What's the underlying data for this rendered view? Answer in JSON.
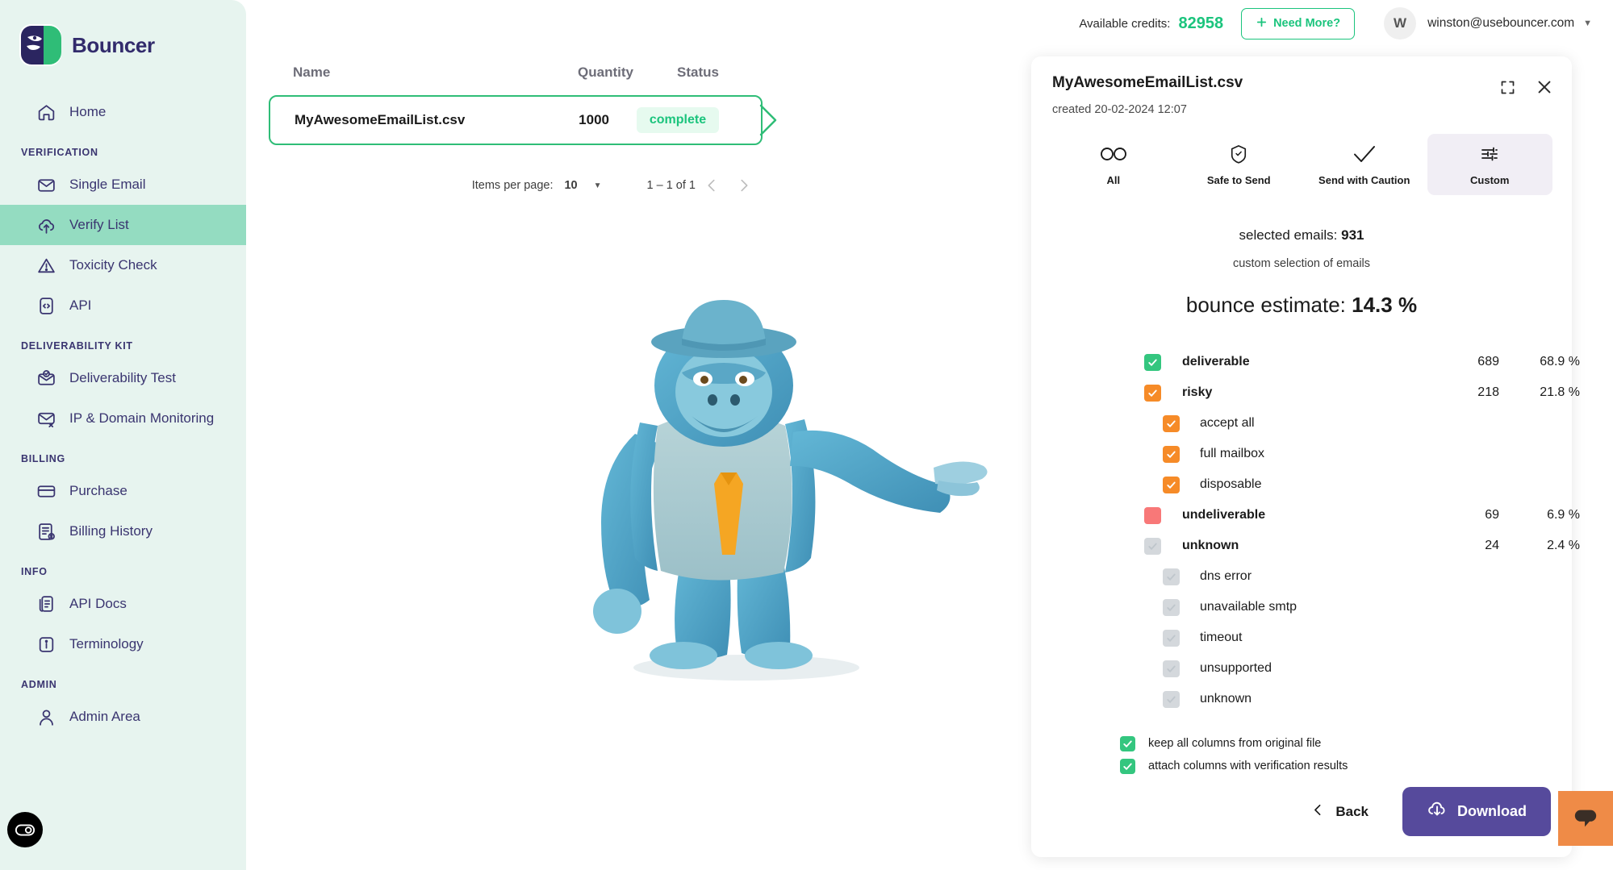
{
  "brand": {
    "name": "Bouncer",
    "logo_icon": "bouncer-gorilla-logo"
  },
  "sidebar": {
    "home": {
      "label": "Home",
      "icon": "home-icon"
    },
    "sections": [
      {
        "title": "VERIFICATION",
        "items": [
          {
            "label": "Single Email",
            "icon": "envelope-icon",
            "active": false
          },
          {
            "label": "Verify List",
            "icon": "cloud-upload-icon",
            "active": true
          },
          {
            "label": "Toxicity Check",
            "icon": "warning-triangle-icon",
            "active": false
          },
          {
            "label": "API",
            "icon": "code-icon",
            "active": false
          }
        ]
      },
      {
        "title": "DELIVERABILITY KIT",
        "items": [
          {
            "label": "Deliverability Test",
            "icon": "envelope-check-icon",
            "active": false
          },
          {
            "label": "IP & Domain Monitoring",
            "icon": "envelope-x-icon",
            "active": false
          }
        ]
      },
      {
        "title": "BILLING",
        "items": [
          {
            "label": "Purchase",
            "icon": "credit-card-icon",
            "active": false
          },
          {
            "label": "Billing History",
            "icon": "invoice-icon",
            "active": false
          }
        ]
      },
      {
        "title": "INFO",
        "items": [
          {
            "label": "API Docs",
            "icon": "document-icon",
            "active": false
          },
          {
            "label": "Terminology",
            "icon": "info-icon",
            "active": false
          }
        ]
      },
      {
        "title": "ADMIN",
        "items": [
          {
            "label": "Admin Area",
            "icon": "user-icon",
            "active": false
          }
        ]
      }
    ],
    "cookie_icon": "cookie-consent-icon"
  },
  "topbar": {
    "credits_label": "Available credits:",
    "credits_value": "82958",
    "need_more_label": "Need More?",
    "plus_icon": "plus-icon",
    "avatar_initial": "W",
    "user_email": "winston@usebouncer.com",
    "caret_icon": "chevron-down-icon"
  },
  "list": {
    "columns": {
      "name": "Name",
      "quantity": "Quantity",
      "status": "Status"
    },
    "rows": [
      {
        "name": "MyAwesomeEmailList.csv",
        "quantity": "1000",
        "status": "complete"
      }
    ],
    "pager": {
      "items_per_page_label": "Items per page:",
      "items_per_page_value": "10",
      "range": "1 – 1 of 1",
      "prev_icon": "chevron-left-icon",
      "next_icon": "chevron-right-icon"
    },
    "mascot_icon": "blue-gorilla-mascot"
  },
  "panel": {
    "title": "MyAwesomeEmailList.csv",
    "created": "created 20-02-2024 12:07",
    "expand_icon": "expand-icon",
    "close_icon": "close-icon",
    "tabs": [
      {
        "label": "All",
        "icon": "infinity-icon",
        "active": false
      },
      {
        "label": "Safe to Send",
        "icon": "shield-check-icon",
        "active": false
      },
      {
        "label": "Send with Caution",
        "icon": "check-icon",
        "active": false
      },
      {
        "label": "Custom",
        "icon": "sliders-icon",
        "active": true
      }
    ],
    "selected_prefix": "selected emails:",
    "selected_count": "931",
    "selection_desc": "custom selection of emails",
    "bounce_prefix": "bounce estimate:",
    "bounce_value": "14.3 %",
    "categories": [
      {
        "label": "deliverable",
        "state": "checked",
        "color": "green",
        "bold": true,
        "sub": false,
        "count": "689",
        "pct": "68.9 %"
      },
      {
        "label": "risky",
        "state": "checked",
        "color": "orange",
        "bold": true,
        "sub": false,
        "count": "218",
        "pct": "21.8 %"
      },
      {
        "label": "accept all",
        "state": "checked",
        "color": "orange",
        "bold": false,
        "sub": true,
        "count": "",
        "pct": ""
      },
      {
        "label": "full mailbox",
        "state": "checked",
        "color": "orange",
        "bold": false,
        "sub": true,
        "count": "",
        "pct": ""
      },
      {
        "label": "disposable",
        "state": "checked",
        "color": "orange",
        "bold": false,
        "sub": true,
        "count": "",
        "pct": ""
      },
      {
        "label": "undeliverable",
        "state": "filled",
        "color": "red",
        "bold": true,
        "sub": false,
        "count": "69",
        "pct": "6.9 %"
      },
      {
        "label": "unknown",
        "state": "disabled",
        "color": "grey",
        "bold": true,
        "sub": false,
        "count": "24",
        "pct": "2.4 %"
      },
      {
        "label": "dns error",
        "state": "disabled",
        "color": "grey",
        "bold": false,
        "sub": true,
        "count": "",
        "pct": ""
      },
      {
        "label": "unavailable smtp",
        "state": "disabled",
        "color": "grey",
        "bold": false,
        "sub": true,
        "count": "",
        "pct": ""
      },
      {
        "label": "timeout",
        "state": "disabled",
        "color": "grey",
        "bold": false,
        "sub": true,
        "count": "",
        "pct": ""
      },
      {
        "label": "unsupported",
        "state": "disabled",
        "color": "grey",
        "bold": false,
        "sub": true,
        "count": "",
        "pct": ""
      },
      {
        "label": "unknown",
        "state": "disabled",
        "color": "grey",
        "bold": false,
        "sub": true,
        "count": "",
        "pct": ""
      }
    ],
    "options": [
      {
        "label": "keep all columns from original file",
        "state": "checked",
        "color": "green"
      },
      {
        "label": "attach columns with verification results",
        "state": "checked",
        "color": "green"
      }
    ],
    "back_label": "Back",
    "back_icon": "chevron-left-icon",
    "download_label": "Download",
    "download_icon": "cloud-download-icon"
  },
  "chat": {
    "icon": "chat-bubble-icon"
  },
  "colors": {
    "sidebar_bg": "#e7f4ef",
    "sidebar_active": "#94dcc1",
    "brand_navy": "#322b6c",
    "green": "#1bc47d",
    "row_border": "#2fbd77",
    "check_green": "#34c67f",
    "orange": "#f68b28",
    "red": "#f87878",
    "grey": "#d4d8dc",
    "purple": "#564a9c",
    "chat_orange": "#ef8b47",
    "tab_active_bg": "#f1eef5"
  }
}
